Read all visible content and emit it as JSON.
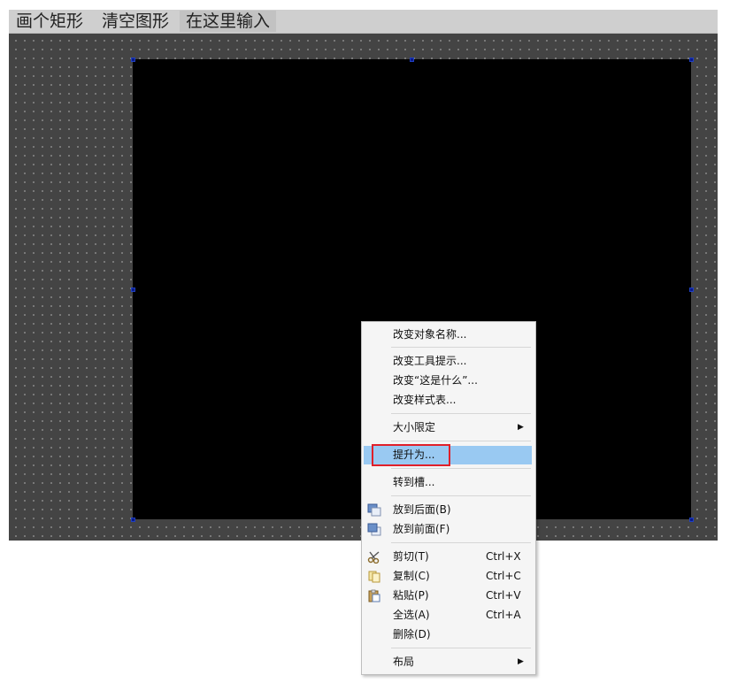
{
  "toolbar": {
    "draw_rect_label": "画个矩形",
    "clear_shapes_label": "清空图形",
    "input_value": "在这里输入"
  },
  "context_menu": {
    "rename": "改变对象名称...",
    "change_tooltip": "改变工具提示...",
    "change_whatsthis": "改变“这是什么”...",
    "change_stylesheet": "改变样式表...",
    "size_constraints": "大小限定",
    "promote_to": "提升为...",
    "go_to_slot": "转到槽...",
    "send_to_back": "放到后面(B)",
    "bring_to_front": "放到前面(F)",
    "cut": "剪切(T)",
    "cut_shortcut": "Ctrl+X",
    "copy": "复制(C)",
    "copy_shortcut": "Ctrl+C",
    "paste": "粘贴(P)",
    "paste_shortcut": "Ctrl+V",
    "select_all": "全选(A)",
    "select_all_shortcut": "Ctrl+A",
    "delete": "删除(D)",
    "layout": "布局",
    "submenu_arrow": "▶"
  },
  "colors": {
    "workspace_bg": "#444444",
    "widget_bg": "#000000",
    "selected_item": "#99c9f2",
    "highlight_border": "#e0202a"
  }
}
